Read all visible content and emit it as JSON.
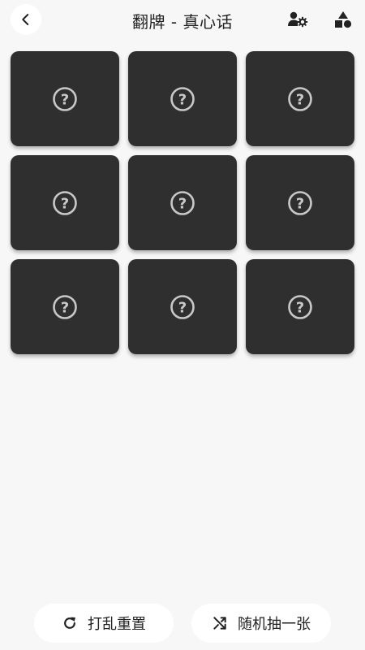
{
  "header": {
    "title": "翻牌 - 真心话",
    "back_icon": "chevron-left-icon",
    "right_icons": [
      "user-settings-icon",
      "shapes-icon"
    ]
  },
  "cards": [
    {
      "face": "?"
    },
    {
      "face": "?"
    },
    {
      "face": "?"
    },
    {
      "face": "?"
    },
    {
      "face": "?"
    },
    {
      "face": "?"
    },
    {
      "face": "?"
    },
    {
      "face": "?"
    },
    {
      "face": "?"
    }
  ],
  "actions": {
    "reset_label": "打乱重置",
    "reset_icon": "refresh-icon",
    "random_label": "随机抽一张",
    "random_icon": "shuffle-icon"
  },
  "colors": {
    "background": "#f7f7f7",
    "card": "#2f2f2f",
    "card_icon": "#c8c8c8",
    "text": "#222222"
  }
}
